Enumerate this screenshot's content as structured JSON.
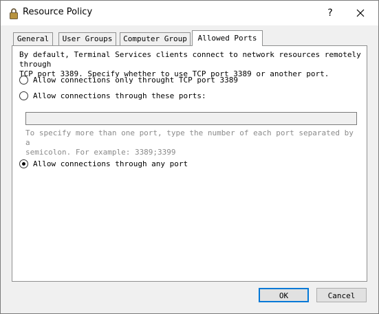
{
  "window": {
    "title": "Resource Policy",
    "help_label": "?",
    "icon": "padlock-icon",
    "close_icon": "close-icon"
  },
  "tabs": [
    {
      "label": "General",
      "active": false
    },
    {
      "label": "User Groups",
      "active": false
    },
    {
      "label": "Computer Group",
      "active": false
    },
    {
      "label": "Allowed Ports",
      "active": true
    }
  ],
  "panel": {
    "description": "By default, Terminal Services clients connect to network resources remotely through\nTCP port 3389. Specify whether to use TCP port 3389 or another port.",
    "options": [
      {
        "label": "Allow connections only throught TCP port 3389",
        "checked": false
      },
      {
        "label": "Allow connections through these ports:",
        "checked": false
      },
      {
        "label": "Allow connections through any port",
        "checked": true
      }
    ],
    "ports_value": "",
    "hint": "To specify more than one port, type the number of each port separated by a\nsemicolon. For example: 3389;3399"
  },
  "buttons": {
    "ok": "OK",
    "cancel": "Cancel"
  },
  "colors": {
    "window_bg": "#f0f0f0",
    "panel_bg": "#ffffff",
    "default_button_border": "#0078d7",
    "disabled_text": "#8a8a8a"
  }
}
